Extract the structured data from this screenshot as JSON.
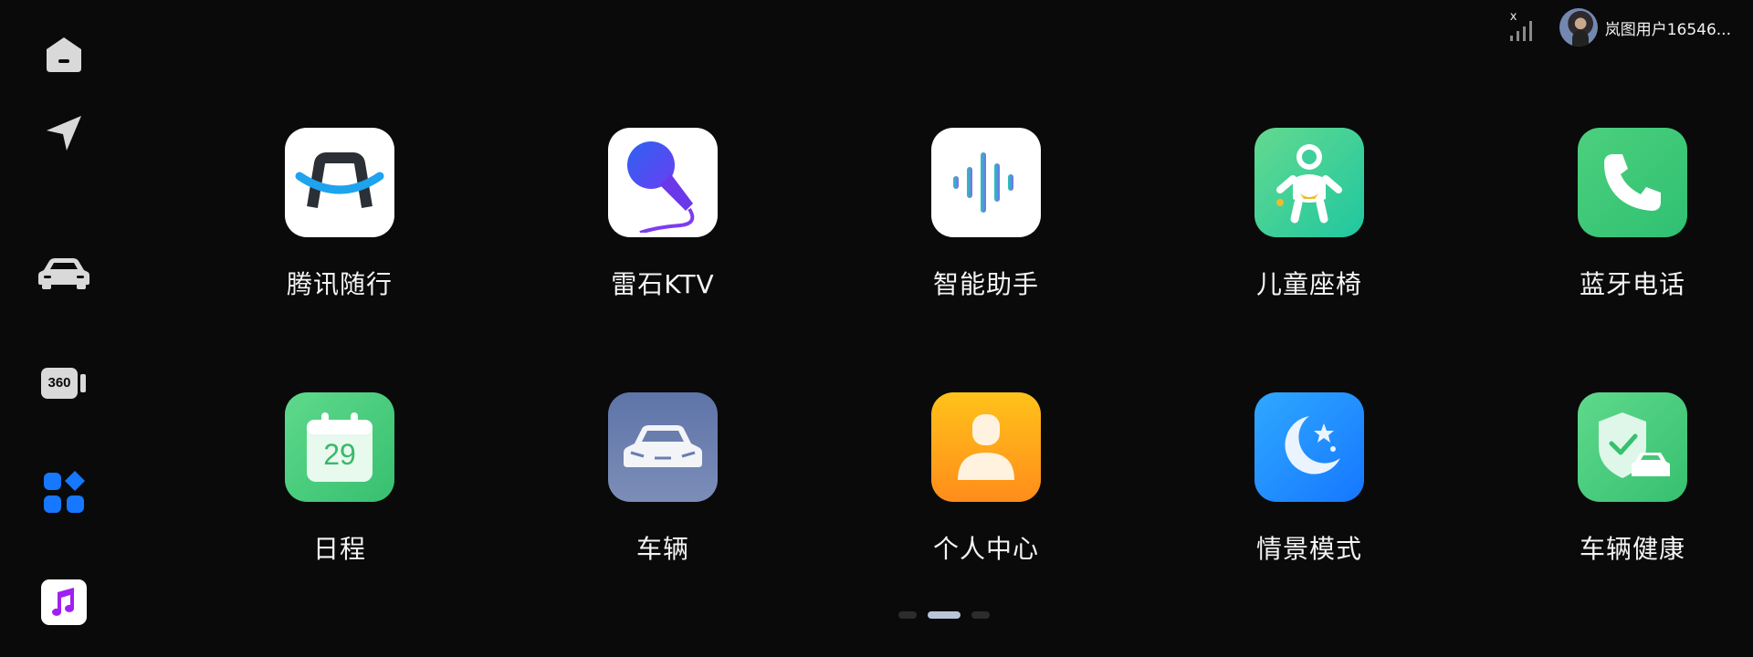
{
  "status": {
    "signal_mark": "x",
    "user_name": "岚图用户16546..."
  },
  "dock": {
    "items": [
      {
        "name": "home",
        "icon": "home-icon"
      },
      {
        "name": "navigation",
        "icon": "navigation-arrow-icon"
      },
      {
        "name": "vehicle",
        "icon": "car-icon"
      },
      {
        "name": "panoramic-camera",
        "icon": "camera-360-icon",
        "label": "360"
      },
      {
        "name": "apps",
        "icon": "apps-grid-icon",
        "color": "#1677ff"
      },
      {
        "name": "music",
        "icon": "music-note-icon",
        "color": "#a020f0"
      }
    ]
  },
  "apps": [
    {
      "label": "腾讯随行",
      "icon": "tencent-suixing-icon"
    },
    {
      "label": "雷石KTV",
      "icon": "microphone-icon"
    },
    {
      "label": "智能助手",
      "icon": "voice-wave-icon"
    },
    {
      "label": "儿童座椅",
      "icon": "baby-icon"
    },
    {
      "label": "蓝牙电话",
      "icon": "phone-icon"
    },
    {
      "label": "日程",
      "icon": "calendar-icon",
      "calendar_day": "29"
    },
    {
      "label": "车辆",
      "icon": "car-front-icon"
    },
    {
      "label": "个人中心",
      "icon": "person-icon"
    },
    {
      "label": "情景模式",
      "icon": "moon-star-icon"
    },
    {
      "label": "车辆健康",
      "icon": "shield-car-icon"
    }
  ],
  "pager": {
    "pages": 3,
    "current": 2
  },
  "colors": {
    "background": "#0a0a0a",
    "accent_blue": "#1677ff",
    "green": "#4cd07d"
  }
}
